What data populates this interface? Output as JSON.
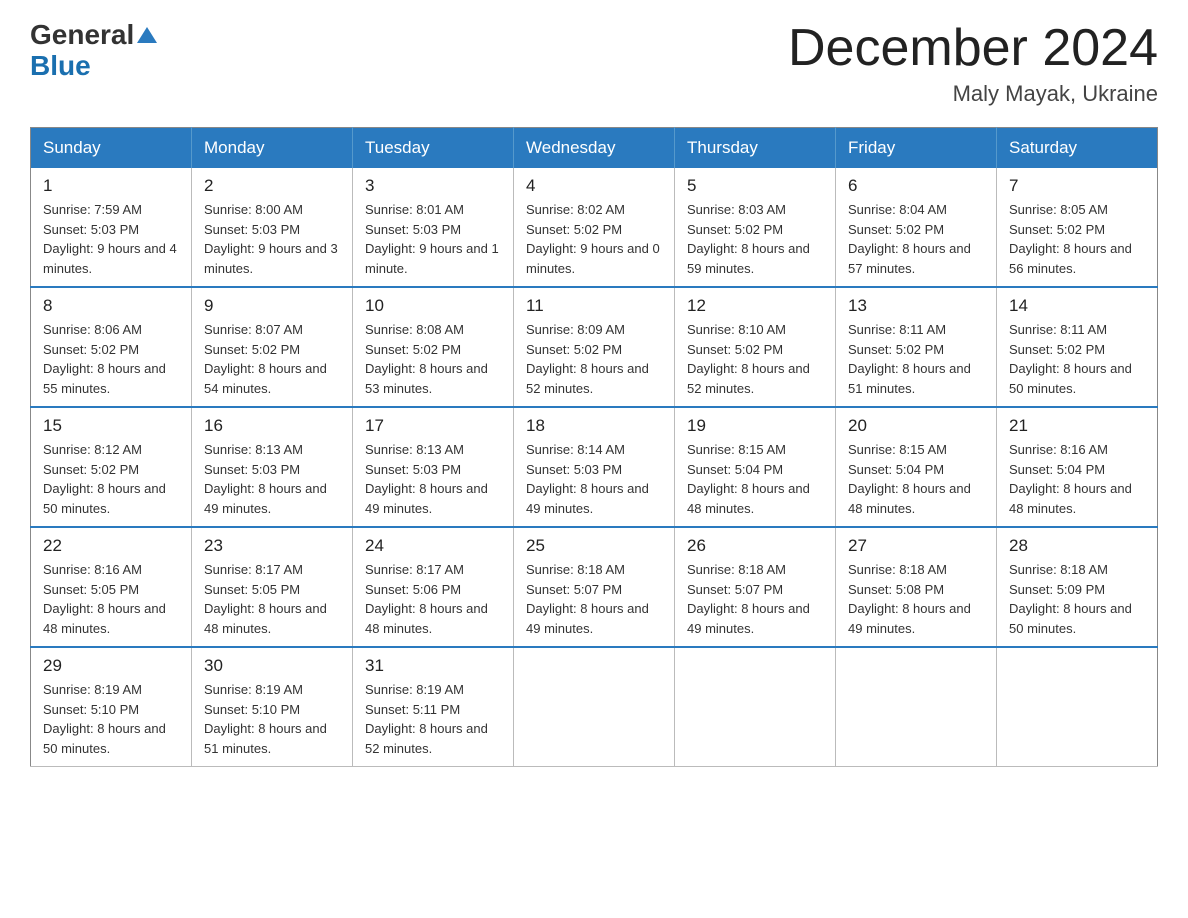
{
  "header": {
    "logo_general": "General",
    "logo_blue": "Blue",
    "month_title": "December 2024",
    "location": "Maly Mayak, Ukraine"
  },
  "days_of_week": [
    "Sunday",
    "Monday",
    "Tuesday",
    "Wednesday",
    "Thursday",
    "Friday",
    "Saturday"
  ],
  "weeks": [
    [
      {
        "day": "1",
        "sunrise": "7:59 AM",
        "sunset": "5:03 PM",
        "daylight": "9 hours and 4 minutes."
      },
      {
        "day": "2",
        "sunrise": "8:00 AM",
        "sunset": "5:03 PM",
        "daylight": "9 hours and 3 minutes."
      },
      {
        "day": "3",
        "sunrise": "8:01 AM",
        "sunset": "5:03 PM",
        "daylight": "9 hours and 1 minute."
      },
      {
        "day": "4",
        "sunrise": "8:02 AM",
        "sunset": "5:02 PM",
        "daylight": "9 hours and 0 minutes."
      },
      {
        "day": "5",
        "sunrise": "8:03 AM",
        "sunset": "5:02 PM",
        "daylight": "8 hours and 59 minutes."
      },
      {
        "day": "6",
        "sunrise": "8:04 AM",
        "sunset": "5:02 PM",
        "daylight": "8 hours and 57 minutes."
      },
      {
        "day": "7",
        "sunrise": "8:05 AM",
        "sunset": "5:02 PM",
        "daylight": "8 hours and 56 minutes."
      }
    ],
    [
      {
        "day": "8",
        "sunrise": "8:06 AM",
        "sunset": "5:02 PM",
        "daylight": "8 hours and 55 minutes."
      },
      {
        "day": "9",
        "sunrise": "8:07 AM",
        "sunset": "5:02 PM",
        "daylight": "8 hours and 54 minutes."
      },
      {
        "day": "10",
        "sunrise": "8:08 AM",
        "sunset": "5:02 PM",
        "daylight": "8 hours and 53 minutes."
      },
      {
        "day": "11",
        "sunrise": "8:09 AM",
        "sunset": "5:02 PM",
        "daylight": "8 hours and 52 minutes."
      },
      {
        "day": "12",
        "sunrise": "8:10 AM",
        "sunset": "5:02 PM",
        "daylight": "8 hours and 52 minutes."
      },
      {
        "day": "13",
        "sunrise": "8:11 AM",
        "sunset": "5:02 PM",
        "daylight": "8 hours and 51 minutes."
      },
      {
        "day": "14",
        "sunrise": "8:11 AM",
        "sunset": "5:02 PM",
        "daylight": "8 hours and 50 minutes."
      }
    ],
    [
      {
        "day": "15",
        "sunrise": "8:12 AM",
        "sunset": "5:02 PM",
        "daylight": "8 hours and 50 minutes."
      },
      {
        "day": "16",
        "sunrise": "8:13 AM",
        "sunset": "5:03 PM",
        "daylight": "8 hours and 49 minutes."
      },
      {
        "day": "17",
        "sunrise": "8:13 AM",
        "sunset": "5:03 PM",
        "daylight": "8 hours and 49 minutes."
      },
      {
        "day": "18",
        "sunrise": "8:14 AM",
        "sunset": "5:03 PM",
        "daylight": "8 hours and 49 minutes."
      },
      {
        "day": "19",
        "sunrise": "8:15 AM",
        "sunset": "5:04 PM",
        "daylight": "8 hours and 48 minutes."
      },
      {
        "day": "20",
        "sunrise": "8:15 AM",
        "sunset": "5:04 PM",
        "daylight": "8 hours and 48 minutes."
      },
      {
        "day": "21",
        "sunrise": "8:16 AM",
        "sunset": "5:04 PM",
        "daylight": "8 hours and 48 minutes."
      }
    ],
    [
      {
        "day": "22",
        "sunrise": "8:16 AM",
        "sunset": "5:05 PM",
        "daylight": "8 hours and 48 minutes."
      },
      {
        "day": "23",
        "sunrise": "8:17 AM",
        "sunset": "5:05 PM",
        "daylight": "8 hours and 48 minutes."
      },
      {
        "day": "24",
        "sunrise": "8:17 AM",
        "sunset": "5:06 PM",
        "daylight": "8 hours and 48 minutes."
      },
      {
        "day": "25",
        "sunrise": "8:18 AM",
        "sunset": "5:07 PM",
        "daylight": "8 hours and 49 minutes."
      },
      {
        "day": "26",
        "sunrise": "8:18 AM",
        "sunset": "5:07 PM",
        "daylight": "8 hours and 49 minutes."
      },
      {
        "day": "27",
        "sunrise": "8:18 AM",
        "sunset": "5:08 PM",
        "daylight": "8 hours and 49 minutes."
      },
      {
        "day": "28",
        "sunrise": "8:18 AM",
        "sunset": "5:09 PM",
        "daylight": "8 hours and 50 minutes."
      }
    ],
    [
      {
        "day": "29",
        "sunrise": "8:19 AM",
        "sunset": "5:10 PM",
        "daylight": "8 hours and 50 minutes."
      },
      {
        "day": "30",
        "sunrise": "8:19 AM",
        "sunset": "5:10 PM",
        "daylight": "8 hours and 51 minutes."
      },
      {
        "day": "31",
        "sunrise": "8:19 AM",
        "sunset": "5:11 PM",
        "daylight": "8 hours and 52 minutes."
      },
      null,
      null,
      null,
      null
    ]
  ]
}
